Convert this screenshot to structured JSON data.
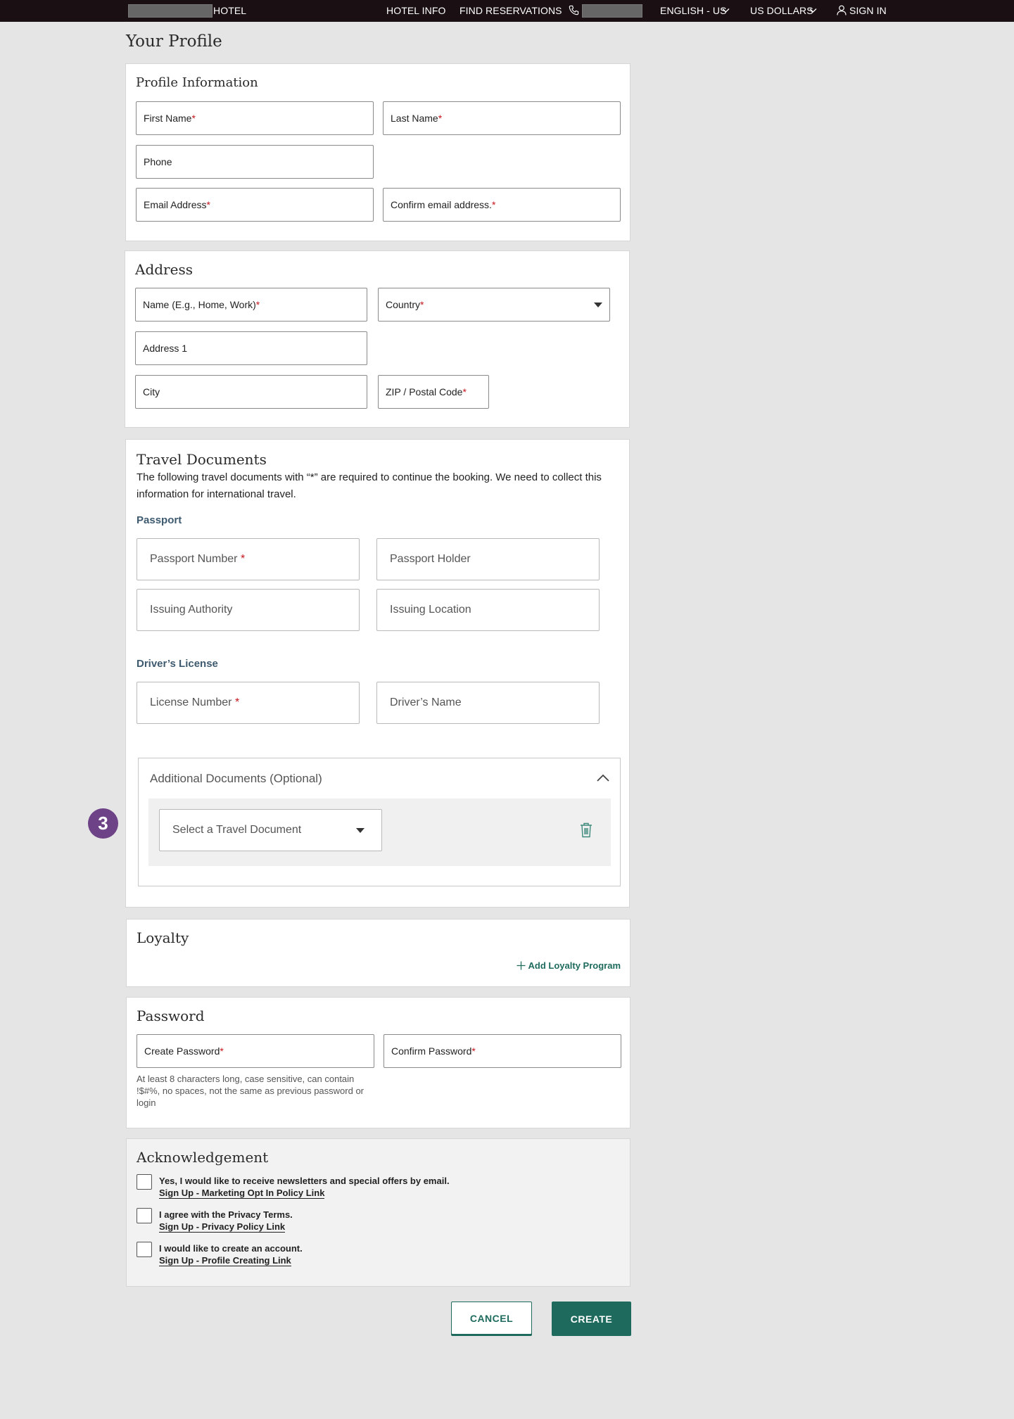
{
  "nav": {
    "brand": "HOTEL",
    "hotel_info": "HOTEL INFO",
    "find_reservations": "FIND RESERVATIONS",
    "language": "ENGLISH - US",
    "currency": "US DOLLARS",
    "sign_in": "SIGN IN"
  },
  "page_title": "Your Profile",
  "profile": {
    "title": "Profile Information",
    "first_name": "First Name",
    "last_name": "Last Name",
    "phone": "Phone",
    "email": "Email Address",
    "confirm_email": "Confirm email address."
  },
  "address": {
    "title": "Address",
    "name": "Name (E.g., Home, Work)",
    "country": "Country",
    "address1": "Address 1",
    "city": "City",
    "zip": "ZIP / Postal Code"
  },
  "travel": {
    "title": "Travel Documents",
    "description": "The following travel documents with “*” are required to continue the booking. We need to collect this information for international travel.",
    "passport_heading": "Passport",
    "passport_number": "Passport Number",
    "passport_holder": "Passport Holder",
    "issuing_authority": "Issuing Authority",
    "issuing_location": "Issuing Location",
    "license_heading": "Driver’s License",
    "license_number": "License Number",
    "drivers_name": "Driver’s Name",
    "additional_title": "Additional Documents (Optional)",
    "select_document": "Select a Travel Document"
  },
  "loyalty": {
    "title": "Loyalty",
    "add_program": "Add Loyalty Program"
  },
  "password": {
    "title": "Password",
    "create": "Create Password",
    "confirm": "Confirm Password",
    "hint": "At least 8 characters long, case sensitive, can contain !$#%, no spaces, not the same as previous password or login"
  },
  "acknowledgement": {
    "title": "Acknowledgement",
    "items": [
      {
        "text": "Yes, I would like to receive newsletters and special offers by email.",
        "link": "Sign Up - Marketing Opt In Policy Link"
      },
      {
        "text": "I agree with the Privacy Terms.",
        "link": "Sign Up - Privacy Policy Link"
      },
      {
        "text": "I would like to create an account.",
        "link": "Sign Up - Profile Creating Link"
      }
    ]
  },
  "buttons": {
    "cancel": "CANCEL",
    "create": "CREATE"
  },
  "step_badge": "3",
  "required_mark": "*",
  "colors": {
    "accent": "#1e6b5e",
    "required": "#c4161c",
    "badge": "#6d4286",
    "nav_bg": "#1a1014"
  }
}
